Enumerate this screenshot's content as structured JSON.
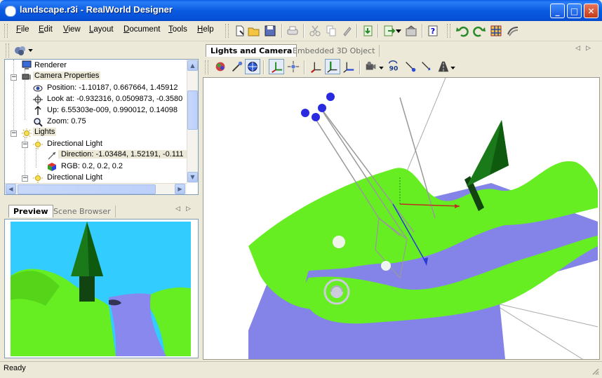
{
  "window": {
    "title": "landscape.r3i - RealWorld Designer"
  },
  "caption_buttons": {
    "minimize": "_",
    "maximize": "□",
    "close": "✕"
  },
  "menu": [
    "File",
    "Edit",
    "View",
    "Layout",
    "Document",
    "Tools",
    "Help"
  ],
  "toolbar_icons": [
    "new-file-icon",
    "open-folder-icon",
    "save-icon",
    "print-icon",
    "cut-icon",
    "copy-icon",
    "paste-icon",
    "import-icon",
    "export-icon",
    "settings-icon",
    "help-icon",
    "undo-icon",
    "redo-icon",
    "grid-icon",
    "render-icon"
  ],
  "tree": {
    "items": [
      {
        "label": "Renderer"
      },
      {
        "label": "Camera Properties"
      },
      {
        "label": "Position: -1.10187, 0.667664, 1.45912"
      },
      {
        "label": "Look at: -0.932316, 0.0509873, -0.3580"
      },
      {
        "label": "Up: 6.55303e-009, 0.990012, 0.14098"
      },
      {
        "label": "Zoom: 0.75"
      },
      {
        "label": "Lights"
      },
      {
        "label": "Directional Light"
      },
      {
        "label": "Direction: -1.03484, 1.52191, -0.111"
      },
      {
        "label": "RGB: 0.2, 0.2, 0.2"
      },
      {
        "label": "Directional Light"
      }
    ]
  },
  "preview_tabs": {
    "active": "Preview",
    "inactive": "Scene Browser"
  },
  "viewport_tabs": {
    "active": "Lights and Camera",
    "inactive": "Embedded 3D Object"
  },
  "status": {
    "text": "Ready"
  },
  "colors": {
    "titlebar": "#0a5be0",
    "terrain": "#66ee22",
    "water": "#8888ee",
    "tree": "#1a7a1a",
    "sky": "#33ccff"
  }
}
